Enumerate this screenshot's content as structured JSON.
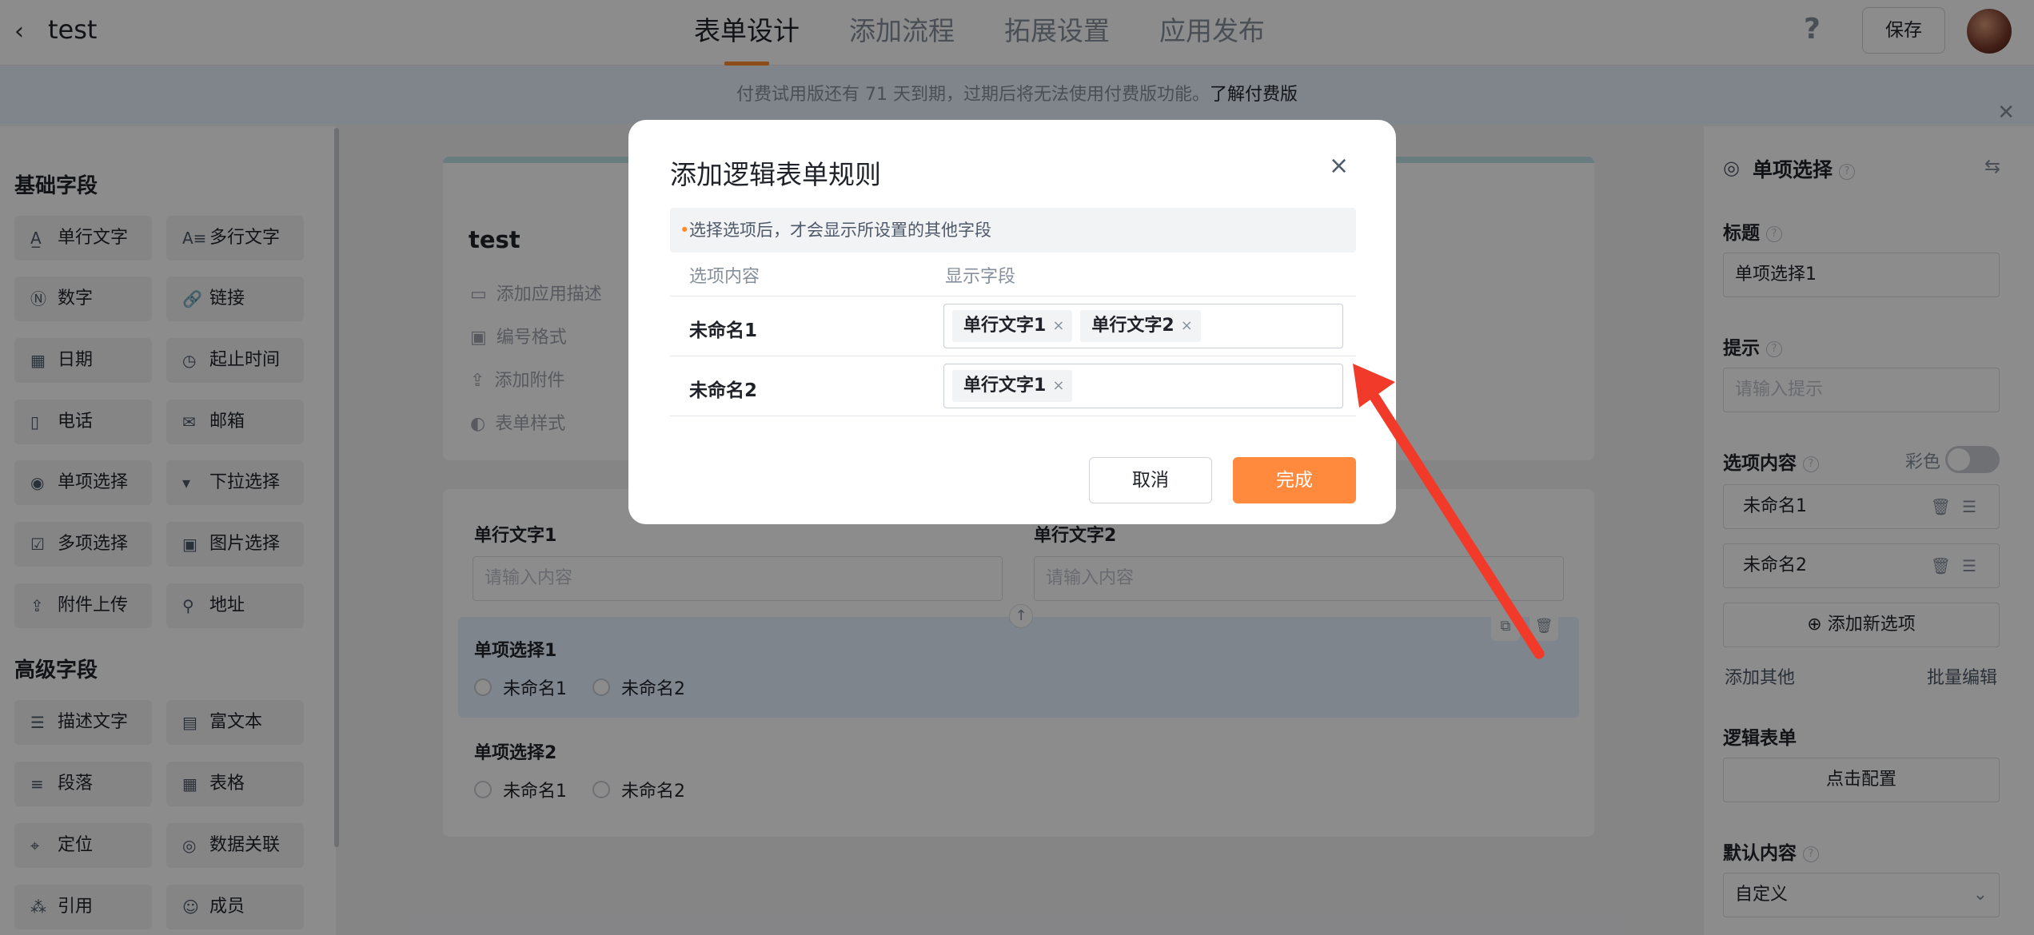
{
  "topbar": {
    "back_icon": "chevron-left-icon",
    "app_title": "test",
    "tabs": [
      "表单设计",
      "添加流程",
      "拓展设置",
      "应用发布"
    ],
    "help_glyph": "?",
    "save_label": "保存"
  },
  "banner": {
    "text": "付费试用版还有 71 天到期，过期后将无法使用付费版功能。",
    "link": "了解付费版"
  },
  "sidebar": {
    "basic_title": "基础字段",
    "basic_fields": [
      {
        "label": "单行文字",
        "icon": "A̲"
      },
      {
        "label": "多行文字",
        "icon": "A≡"
      },
      {
        "label": "数字",
        "icon": "Ⓝ"
      },
      {
        "label": "链接",
        "icon": "🔗"
      },
      {
        "label": "日期",
        "icon": "▦"
      },
      {
        "label": "起止时间",
        "icon": "◷"
      },
      {
        "label": "电话",
        "icon": "▯"
      },
      {
        "label": "邮箱",
        "icon": "✉"
      },
      {
        "label": "单项选择",
        "icon": "◉"
      },
      {
        "label": "下拉选择",
        "icon": "▾"
      },
      {
        "label": "多项选择",
        "icon": "☑"
      },
      {
        "label": "图片选择",
        "icon": "▣"
      },
      {
        "label": "附件上传",
        "icon": "⇪"
      },
      {
        "label": "地址",
        "icon": "⚲"
      }
    ],
    "advanced_title": "高级字段",
    "advanced_fields": [
      {
        "label": "描述文字",
        "icon": "☰"
      },
      {
        "label": "富文本",
        "icon": "▤"
      },
      {
        "label": "段落",
        "icon": "≡"
      },
      {
        "label": "表格",
        "icon": "▦"
      },
      {
        "label": "定位",
        "icon": "⌖"
      },
      {
        "label": "数据关联",
        "icon": "◎"
      },
      {
        "label": "引用",
        "icon": "⁂"
      },
      {
        "label": "成员",
        "icon": "☺"
      }
    ]
  },
  "form": {
    "title": "test",
    "meta": [
      {
        "label": "添加应用描述",
        "icon": "▭"
      },
      {
        "label": "编号格式",
        "icon": "▣"
      },
      {
        "label": "添加附件",
        "icon": "⇪"
      },
      {
        "label": "表单样式",
        "icon": "◐"
      }
    ],
    "field1_label": "单行文字1",
    "field1_placeholder": "请输入内容",
    "field2_label": "单行文字2",
    "field2_placeholder": "请输入内容",
    "radio1_label": "单项选择1",
    "radio1_options": [
      "未命名1",
      "未命名2"
    ],
    "radio2_label": "单项选择2",
    "radio2_options": [
      "未命名1",
      "未命名2"
    ],
    "arrow_up_glyph": "↑",
    "copy_glyph": "⧉",
    "trash_glyph": "🗑"
  },
  "right_panel": {
    "header": "单项选择",
    "title_label": "标题",
    "title_value": "单项选择1",
    "hint_label": "提示",
    "hint_placeholder": "请输入提示",
    "options_label": "选项内容",
    "color_label": "彩色",
    "options": [
      "未命名1",
      "未命名2"
    ],
    "add_option": "添加新选项",
    "add_other": "添加其他",
    "bulk_edit": "批量编辑",
    "logic_label": "逻辑表单",
    "logic_button": "点击配置",
    "default_label": "默认内容",
    "default_value": "自定义"
  },
  "modal": {
    "title": "添加逻辑表单规则",
    "close_glyph": "×",
    "tip": "选择选项后，才会显示所设置的其他字段",
    "col_option": "选项内容",
    "col_fields": "显示字段",
    "rows": [
      {
        "name": "未命名1",
        "tags": [
          "单行文字1",
          "单行文字2"
        ]
      },
      {
        "name": "未命名2",
        "tags": [
          "单行文字1"
        ]
      }
    ],
    "cancel": "取消",
    "done": "完成"
  },
  "colors": {
    "accent": "#ff8a3d",
    "annotation_arrow": "#f23a2a"
  }
}
